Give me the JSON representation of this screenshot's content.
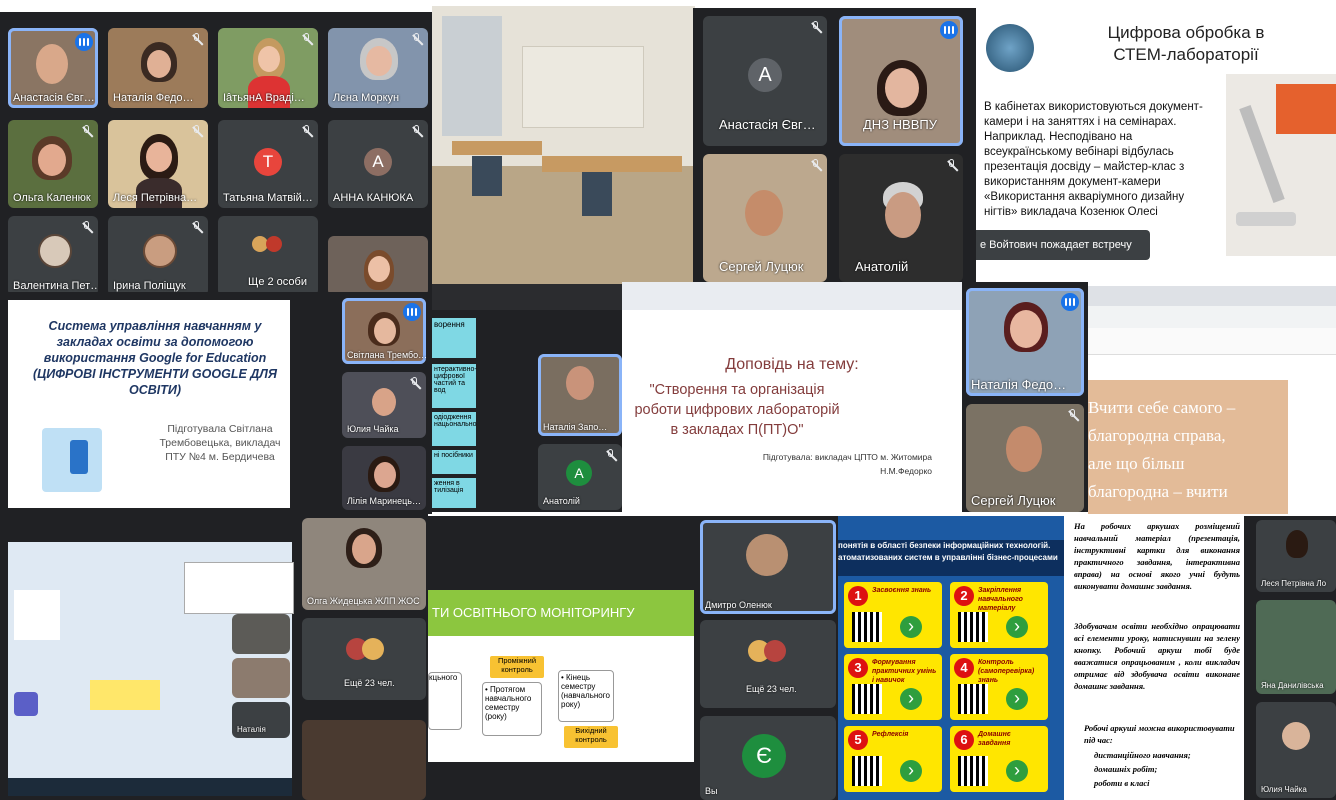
{
  "p1": {
    "tiles": [
      "Анастасія Євг…",
      "Наталія Федо…",
      "ІâтьянА Враді…",
      "Лєна Моркун",
      "Ольга Каленюк",
      "Леся Петрівна…",
      "Татьяна Матвій…",
      "АННА КАНЮКА",
      "Валентина Пет…",
      "Ірина Поліщук",
      "Ще 2 особи",
      ""
    ],
    "avatar_t": "Т",
    "avatar_a": "А",
    "colors": {
      "t": "#e8453c",
      "a": "#8d6e63"
    }
  },
  "p3": {
    "anastasia": "Анастасія Євг…",
    "avatar": "А",
    "dnz": "ДНЗ НВВПУ",
    "serhii": "Сергей Луцюк",
    "anatolii": "Анатолій"
  },
  "p4": {
    "title": "Цифрова обробка в СТЕМ-лабораторії",
    "body": "В кабінетах використовуються документ-камери і на заняттях і на семінарах. Наприклад. Несподівано на всеукраїнському вебінарі відбулась презентація досвіду – майстер-клас з використанням документ-камери «Використання акваріумного дизайну нігтів» викладача Козенюк Олесі",
    "toast": "е Войтович пожадает встречу"
  },
  "p5": {
    "title": "Система управління навчанням у закладах освіти за допомогою використання Google for Education (ЦИФРОВІ ІНСТРУМЕНТИ GOOGLE ДЛЯ ОСВІТИ)",
    "sub": "Підготувала Світлана Трембовецька, викладач ПТУ №4 м. Бердичева",
    "side": [
      "Світлана Трембо…",
      "Юлия Чайка",
      "Лілія Маринець…"
    ]
  },
  "p6": {
    "labels": [
      "ворення",
      "нтерактивно- цифрової частий та вод",
      "одіодження нацьонально",
      "ні посібники",
      "ження в тилізація"
    ],
    "tile": "Наталія Запо…",
    "anatolii": "Анатолій",
    "avatar": "А"
  },
  "p7": {
    "l1": "Доповідь на тему:",
    "l2": "\"Створення та організація роботи цифрових лабораторій в закладах П(ПТ)О\"",
    "l3": "Підготувала: викладач ЦПТО м. Житомира Н.М.Федорко",
    "nat": "Наталія Федо…",
    "serh": "Сергей Луцюк"
  },
  "p8": {
    "quote": [
      "Вчити себе самого –",
      "благородна справа,",
      "але що більш",
      "благородна – вчити"
    ]
  },
  "p9": {
    "top": "Олга Жидецька ЖЛП ЖОС",
    "more": "Ещё 23 чел.",
    "small": "Наталія"
  },
  "p10": {
    "header": "ТИ ОСВІТНЬОГО МОНІТОРИНГУ",
    "b1": "Проміжний контроль",
    "b2": "• Протягом навчального семестру (року)",
    "b3": "• Кінець семестру (навчального року)",
    "b4": "Вихідний контроль",
    "b5": "кцьного",
    "tile1": "Дмитро Оленюк",
    "more": "Ещё 23 чел.",
    "avatar": "Є",
    "you": "Вы"
  },
  "p11": {
    "banner": "понятія в області безпеки інформаційних технологій. атоматизованих систем в управлінні бізнес-процесами",
    "items": [
      {
        "n": "1",
        "t": "Засвоєння знань"
      },
      {
        "n": "2",
        "t": "Закріплення навчального матеріалу"
      },
      {
        "n": "3",
        "t": "Формування практичних умінь і навичок"
      },
      {
        "n": "4",
        "t": "Контроль (самоперевірка) знань"
      },
      {
        "n": "5",
        "t": "Рефлексія"
      },
      {
        "n": "6",
        "t": "Домашнє завдання"
      }
    ],
    "p1": "На робочих аркушах розміщений навчальний матеріал (презентація, інструктивні картки для виконання практичного завдання, інтерактивна вправа) на основі якого учні будуть виконувати домашнє завдання.",
    "p2": "Здобувачам освіти необхідно опрацювати всі елементи уроку, натиснувши на зелену кнопку. Робочий аркуш тобі буде вважатися опрацьованим , коли викладач отримає від здобувача освіти виконане домашнє завдання.",
    "p3": "Робочі аркуші можна використовувати під час:",
    "bullets": [
      "дистанційного навчання;",
      "домашніх робіт;",
      "роботи в класі"
    ],
    "side": [
      "Леся Петрівна Ло",
      "Яна Данилівська",
      "Юлия Чайка"
    ]
  }
}
